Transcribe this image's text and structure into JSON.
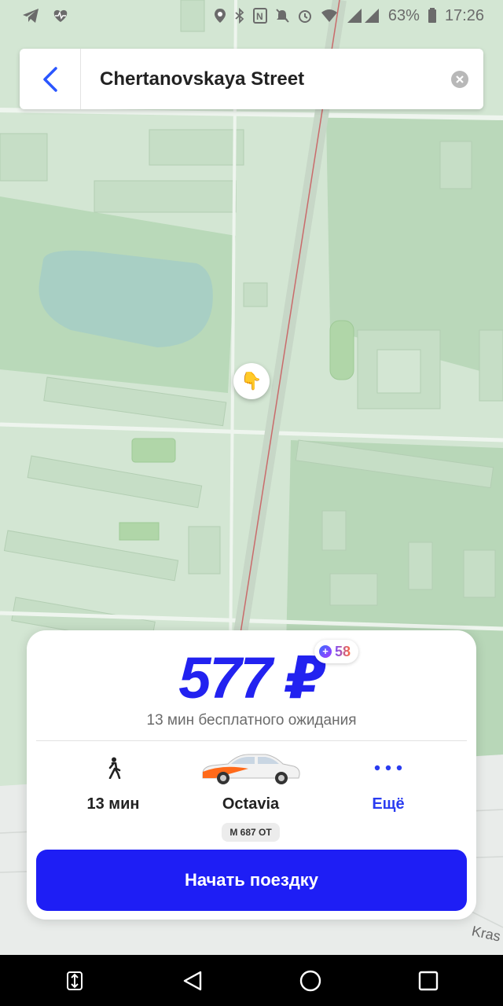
{
  "status_bar": {
    "battery_percent": "63%",
    "time": "17:26"
  },
  "search": {
    "text": "Chertanovskaya Street"
  },
  "map": {
    "street_label": "Kras",
    "pin_icon": "pointing-down-hand"
  },
  "ride_card": {
    "price": "577 ₽",
    "plus_points": "58",
    "free_waiting": "13 мин бесплатного ожидания",
    "options": {
      "walk": {
        "label": "13 мин",
        "icon": "walking-person-icon"
      },
      "car": {
        "label": "Octavia",
        "plate": "М 687 ОТ",
        "icon": "car-icon"
      },
      "more": {
        "label": "Ещё",
        "icon": "more-dots-icon"
      }
    },
    "start_button": "Начать поездку"
  },
  "colors": {
    "accent": "#1e1ef5",
    "price": "#2222f0",
    "map_green": "#cfe3cf"
  }
}
